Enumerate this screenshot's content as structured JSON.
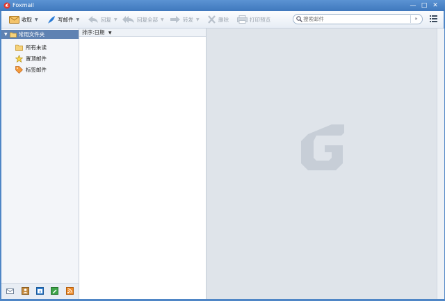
{
  "window": {
    "title": "Foxmail",
    "minimize": "—",
    "maximize": "□",
    "close": "✕"
  },
  "toolbar": {
    "receive": "收取",
    "compose": "写邮件",
    "reply": "回复",
    "reply_all": "回复全部",
    "forward": "转发",
    "delete": "删除",
    "print_preview": "打印预览"
  },
  "search": {
    "placeholder": "搜索邮件",
    "options": "»"
  },
  "sidebar": {
    "header": "常用文件夹",
    "items": [
      {
        "label": "所有未读",
        "icon": "folder-icon"
      },
      {
        "label": "置顶邮件",
        "icon": "star-icon"
      },
      {
        "label": "标签邮件",
        "icon": "tag-icon"
      }
    ],
    "bottom_icons": [
      "mail-icon",
      "contacts-icon",
      "calendar-icon",
      "notes-icon",
      "rss-icon"
    ]
  },
  "list": {
    "sort_label": "排序:日期"
  },
  "colors": {
    "accent": "#4f86c6",
    "header_bg": "#5f82b2",
    "preview_bg": "#dfe4ea"
  }
}
